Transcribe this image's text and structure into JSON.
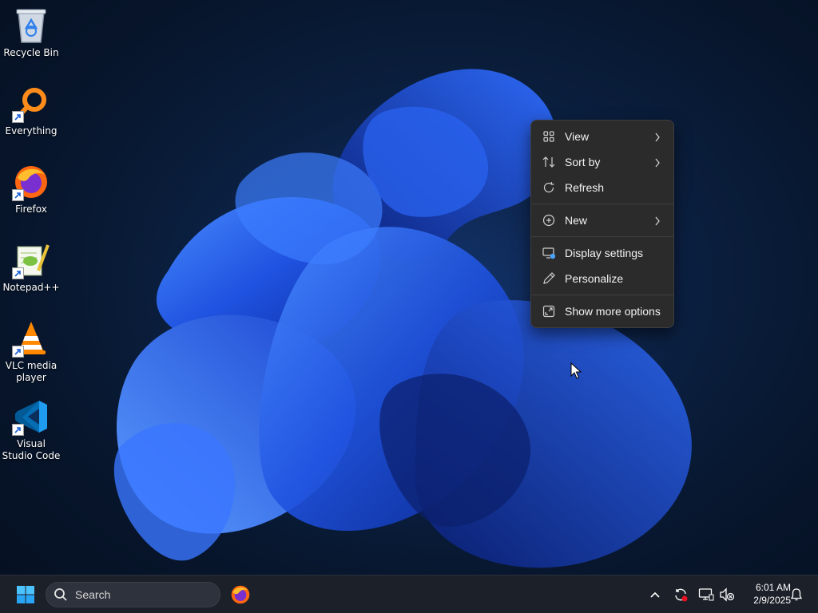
{
  "desktop": {
    "icons": [
      {
        "label": "Recycle Bin",
        "icon": "recycle-bin-icon"
      },
      {
        "label": "Everything",
        "icon": "everything-search-icon"
      },
      {
        "label": "Firefox",
        "icon": "firefox-icon"
      },
      {
        "label": "Notepad++",
        "icon": "notepadpp-icon"
      },
      {
        "label": "VLC media player",
        "icon": "vlc-icon"
      },
      {
        "label": "Visual Studio Code",
        "icon": "vscode-icon"
      }
    ]
  },
  "context_menu": {
    "items": [
      {
        "label": "View",
        "icon": "grid-icon",
        "has_submenu": true
      },
      {
        "label": "Sort by",
        "icon": "sort-icon",
        "has_submenu": true
      },
      {
        "label": "Refresh",
        "icon": "refresh-icon",
        "has_submenu": false
      },
      {
        "label": "New",
        "icon": "plus-circle-icon",
        "has_submenu": true
      },
      {
        "label": "Display settings",
        "icon": "display-settings-icon",
        "has_submenu": false
      },
      {
        "label": "Personalize",
        "icon": "pen-icon",
        "has_submenu": false
      },
      {
        "label": "Show more options",
        "icon": "expand-icon",
        "has_submenu": false
      }
    ]
  },
  "taskbar": {
    "search_placeholder": "Search",
    "pinned": [
      {
        "name": "Firefox",
        "icon": "firefox-icon"
      }
    ],
    "clock": {
      "time": "6:01 AM",
      "date": "2/9/2025"
    }
  },
  "colors": {
    "menu_bg": "#2b2b2b",
    "taskbar_bg": "#1c2029",
    "accent": "#1f6feb"
  }
}
